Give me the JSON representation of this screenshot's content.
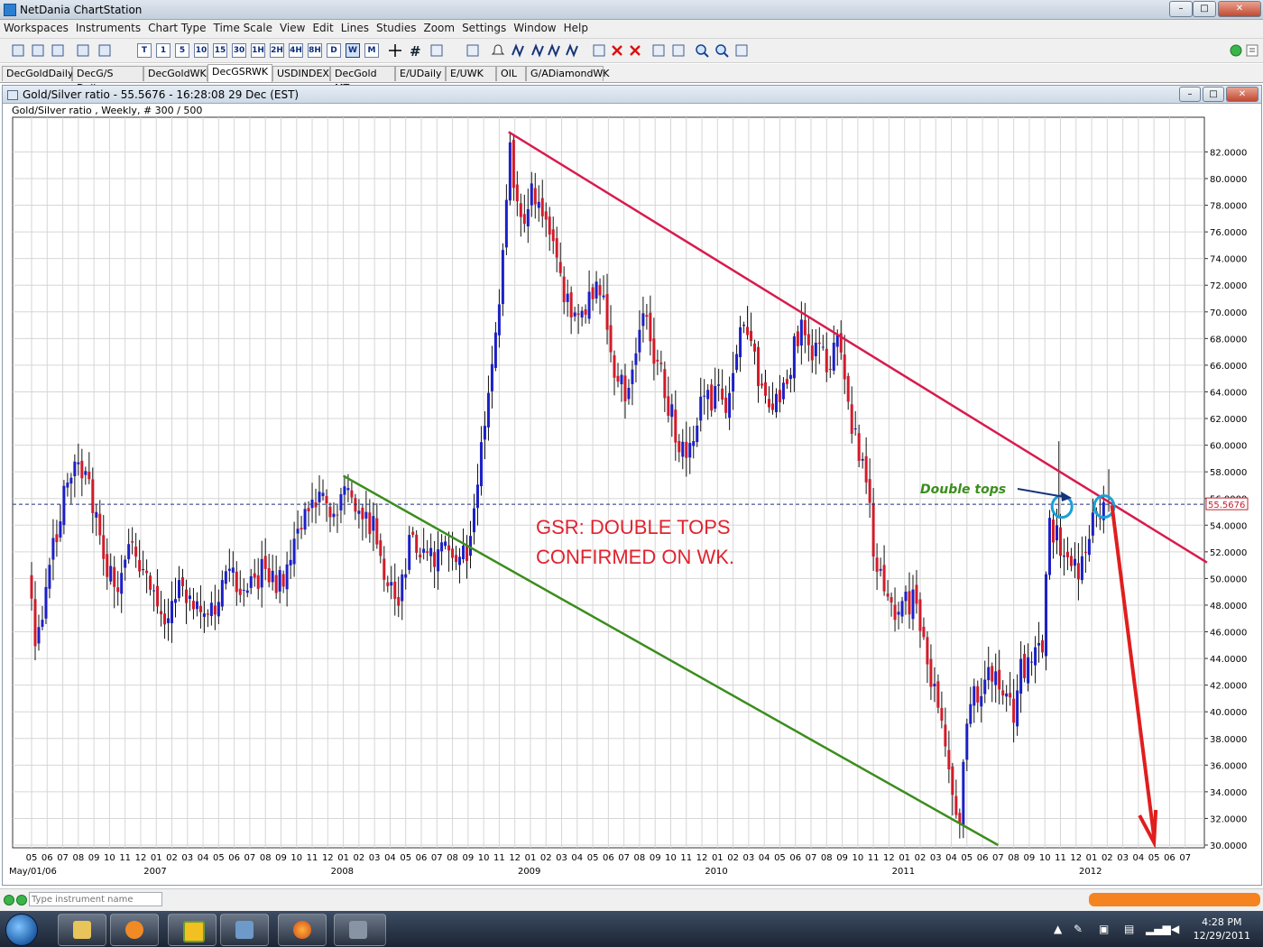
{
  "window": {
    "title": "NetDania ChartStation",
    "min": "–",
    "max": "□",
    "close": "✕"
  },
  "menu": [
    "Workspaces",
    "Instruments",
    "Chart Type",
    "Time Scale",
    "View",
    "Edit",
    "Lines",
    "Studies",
    "Zoom",
    "Settings",
    "Window",
    "Help"
  ],
  "toolbar": {
    "timeframes": [
      "T",
      "1",
      "5",
      "10",
      "15",
      "30",
      "1H",
      "2H",
      "4H",
      "8H",
      "D",
      "W",
      "M"
    ],
    "icons": [
      "new-icon",
      "open-icon",
      "save-icon",
      "line-chart-icon",
      "crosshair-icon",
      "grid-icon",
      "studies-icon",
      "bar-study-icon",
      "alert-icon",
      "trend-icon",
      "trend-icon",
      "trend-icon",
      "trend-icon",
      "fib-icon",
      "delete-icon",
      "delete-all-icon",
      "print-icon",
      "print-preview-icon",
      "zoom-in-icon",
      "zoom-out-icon",
      "zoom-reset-icon"
    ]
  },
  "tabs": [
    "DecGoldDaily",
    "DecG/S Daily",
    "DecGoldWK",
    "DecGSRWK",
    "USDINDEX",
    "DecGold MT",
    "E/UDaily",
    "E/UWK",
    "OIL",
    "G/ADiamondWK"
  ],
  "active_tab": "DecGSRWK",
  "chart_window": {
    "title": "Gold/Silver ratio - 55.5676 - 16:28:08  29 Dec (EST)",
    "subtitle": "Gold/Silver ratio , Weekly, # 300 / 500"
  },
  "status": {
    "instrument_placeholder": "Type instrument name"
  },
  "taskbar": {
    "time": "4:28 PM",
    "date": "12/29/2011"
  },
  "chart_data": {
    "type": "candlestick",
    "title": "Gold/Silver ratio , Weekly, # 300 / 500",
    "current_value": 55.5676,
    "current_value_label": "55.5676",
    "ylim": [
      30,
      84
    ],
    "y_ticks": [
      "30.0000",
      "32.0000",
      "34.0000",
      "36.0000",
      "38.0000",
      "40.0000",
      "42.0000",
      "44.0000",
      "46.0000",
      "48.0000",
      "50.0000",
      "52.0000",
      "54.0000",
      "56.0000",
      "58.0000",
      "60.0000",
      "62.0000",
      "64.0000",
      "66.0000",
      "68.0000",
      "70.0000",
      "72.0000",
      "74.0000",
      "76.0000",
      "78.0000",
      "80.0000",
      "82.0000"
    ],
    "x_month_labels": [
      "05",
      "06",
      "07",
      "08",
      "09",
      "10",
      "11",
      "12",
      "01",
      "02",
      "03",
      "04",
      "05",
      "06",
      "07",
      "08",
      "09",
      "10",
      "11",
      "12",
      "01",
      "02",
      "03",
      "04",
      "05",
      "06",
      "07",
      "08",
      "09",
      "10",
      "11",
      "12",
      "01",
      "02",
      "03",
      "04",
      "05",
      "06",
      "07",
      "08",
      "09",
      "10",
      "11",
      "12",
      "01",
      "02",
      "03",
      "04",
      "05",
      "06",
      "07",
      "08",
      "09",
      "10",
      "11",
      "12",
      "01",
      "02",
      "03",
      "04",
      "05",
      "06",
      "07",
      "08",
      "09",
      "10",
      "11",
      "12",
      "01",
      "02",
      "03",
      "04",
      "05",
      "06",
      "07"
    ],
    "x_year_labels": [
      "May/01/06",
      "2007",
      "2008",
      "2009",
      "2010",
      "2011",
      "2012"
    ],
    "x_year_label_months": [
      0,
      8,
      20,
      32,
      44,
      56,
      68
    ],
    "annotations": {
      "main_text_line1": "GSR: DOUBLE TOPS",
      "main_text_line2": "CONFIRMED ON WK.",
      "double_tops": "Double tops"
    },
    "trendlines": [
      {
        "name": "resistance",
        "color": "#d81b4e",
        "start": {
          "month": 30.6,
          "value": 83.5
        },
        "end": {
          "month": 75.4,
          "value": 51.2
        }
      },
      {
        "name": "support",
        "color": "#3c8d1e",
        "start": {
          "month": 20.0,
          "value": 57.7
        },
        "end": {
          "month": 62.0,
          "value": 30.0
        }
      }
    ],
    "forecast_arrow": {
      "color": "#e01e1e",
      "start": {
        "month": 69.3,
        "value": 55.5
      },
      "end": {
        "month": 72.0,
        "value": 30.2
      }
    },
    "circles": [
      {
        "month": 66.1,
        "value": 55.4
      },
      {
        "month": 68.8,
        "value": 55.4
      }
    ],
    "key_points": [
      {
        "month": 0.0,
        "value": 50.5
      },
      {
        "month": 0.5,
        "value": 45.0
      },
      {
        "month": 1.5,
        "value": 52.0
      },
      {
        "month": 2.5,
        "value": 57.0
      },
      {
        "month": 3.5,
        "value": 58.5
      },
      {
        "month": 4.5,
        "value": 53.5
      },
      {
        "month": 5.5,
        "value": 49.0
      },
      {
        "month": 6.5,
        "value": 53.0
      },
      {
        "month": 7.5,
        "value": 50.0
      },
      {
        "month": 8.5,
        "value": 47.0
      },
      {
        "month": 9.0,
        "value": 46.0
      },
      {
        "month": 9.5,
        "value": 49.5
      },
      {
        "month": 11.0,
        "value": 48.5
      },
      {
        "month": 11.8,
        "value": 47.2
      },
      {
        "month": 12.5,
        "value": 50.0
      },
      {
        "month": 14.0,
        "value": 49.5
      },
      {
        "month": 15.0,
        "value": 50.5
      },
      {
        "month": 16.0,
        "value": 49.3
      },
      {
        "month": 17.0,
        "value": 52.0
      },
      {
        "month": 17.7,
        "value": 54.5
      },
      {
        "month": 18.3,
        "value": 56.0
      },
      {
        "month": 19.3,
        "value": 55.0
      },
      {
        "month": 20.3,
        "value": 56.5
      },
      {
        "month": 21.3,
        "value": 55.5
      },
      {
        "month": 22.3,
        "value": 53.5
      },
      {
        "month": 23.0,
        "value": 49.0
      },
      {
        "month": 23.7,
        "value": 48.5
      },
      {
        "month": 24.5,
        "value": 52.5
      },
      {
        "month": 25.5,
        "value": 51.5
      },
      {
        "month": 26.5,
        "value": 51.8
      },
      {
        "month": 27.5,
        "value": 51.5
      },
      {
        "month": 28.3,
        "value": 52.5
      },
      {
        "month": 28.8,
        "value": 55.5
      },
      {
        "month": 29.2,
        "value": 61.5
      },
      {
        "month": 29.7,
        "value": 65.5
      },
      {
        "month": 30.1,
        "value": 70.0
      },
      {
        "month": 30.5,
        "value": 74.0
      },
      {
        "month": 30.9,
        "value": 82.5
      },
      {
        "month": 31.5,
        "value": 76.0
      },
      {
        "month": 32.2,
        "value": 79.0
      },
      {
        "month": 33.0,
        "value": 77.5
      },
      {
        "month": 33.7,
        "value": 75.0
      },
      {
        "month": 34.3,
        "value": 71.0
      },
      {
        "month": 35.0,
        "value": 70.0
      },
      {
        "month": 35.7,
        "value": 70.5
      },
      {
        "month": 36.3,
        "value": 71.5
      },
      {
        "month": 37.0,
        "value": 71.0
      },
      {
        "month": 37.6,
        "value": 66.0
      },
      {
        "month": 38.3,
        "value": 64.0
      },
      {
        "month": 38.9,
        "value": 67.0
      },
      {
        "month": 39.5,
        "value": 70.0
      },
      {
        "month": 40.1,
        "value": 67.0
      },
      {
        "month": 40.7,
        "value": 65.0
      },
      {
        "month": 41.3,
        "value": 62.0
      },
      {
        "month": 41.9,
        "value": 59.5
      },
      {
        "month": 42.5,
        "value": 60.0
      },
      {
        "month": 43.1,
        "value": 63.0
      },
      {
        "month": 43.7,
        "value": 63.5
      },
      {
        "month": 44.3,
        "value": 64.0
      },
      {
        "month": 44.9,
        "value": 62.0
      },
      {
        "month": 45.5,
        "value": 68.0
      },
      {
        "month": 46.0,
        "value": 70.0
      },
      {
        "month": 46.6,
        "value": 66.0
      },
      {
        "month": 47.2,
        "value": 64.5
      },
      {
        "month": 47.8,
        "value": 63.5
      },
      {
        "month": 48.4,
        "value": 64.5
      },
      {
        "month": 49.0,
        "value": 66.5
      },
      {
        "month": 49.6,
        "value": 69.5
      },
      {
        "month": 50.2,
        "value": 67.5
      },
      {
        "month": 50.8,
        "value": 67.0
      },
      {
        "month": 51.4,
        "value": 66.0
      },
      {
        "month": 52.0,
        "value": 67.5
      },
      {
        "month": 52.6,
        "value": 63.0
      },
      {
        "month": 53.2,
        "value": 60.0
      },
      {
        "month": 53.8,
        "value": 56.5
      },
      {
        "month": 54.4,
        "value": 51.0
      },
      {
        "month": 55.0,
        "value": 48.5
      },
      {
        "month": 55.6,
        "value": 47.0
      },
      {
        "month": 56.2,
        "value": 48.0
      },
      {
        "month": 56.8,
        "value": 48.5
      },
      {
        "month": 57.4,
        "value": 46.5
      },
      {
        "month": 58.0,
        "value": 42.0
      },
      {
        "month": 58.6,
        "value": 38.5
      },
      {
        "month": 59.2,
        "value": 35.0
      },
      {
        "month": 59.7,
        "value": 31.5
      },
      {
        "month": 60.2,
        "value": 40.0
      },
      {
        "month": 60.7,
        "value": 42.0
      },
      {
        "month": 61.2,
        "value": 41.5
      },
      {
        "month": 61.7,
        "value": 43.5
      },
      {
        "month": 62.2,
        "value": 43.0
      },
      {
        "month": 62.7,
        "value": 41.0
      },
      {
        "month": 63.2,
        "value": 40.0
      },
      {
        "month": 63.7,
        "value": 43.0
      },
      {
        "month": 64.2,
        "value": 43.5
      },
      {
        "month": 64.7,
        "value": 44.0
      },
      {
        "month": 65.1,
        "value": 45.0
      },
      {
        "month": 65.5,
        "value": 54.0
      },
      {
        "month": 66.0,
        "value": 53.0
      },
      {
        "month": 66.5,
        "value": 51.5
      },
      {
        "month": 67.0,
        "value": 50.5
      },
      {
        "month": 67.5,
        "value": 51.0
      },
      {
        "month": 68.0,
        "value": 53.0
      },
      {
        "month": 68.5,
        "value": 54.5
      },
      {
        "month": 69.0,
        "value": 55.6
      }
    ]
  }
}
